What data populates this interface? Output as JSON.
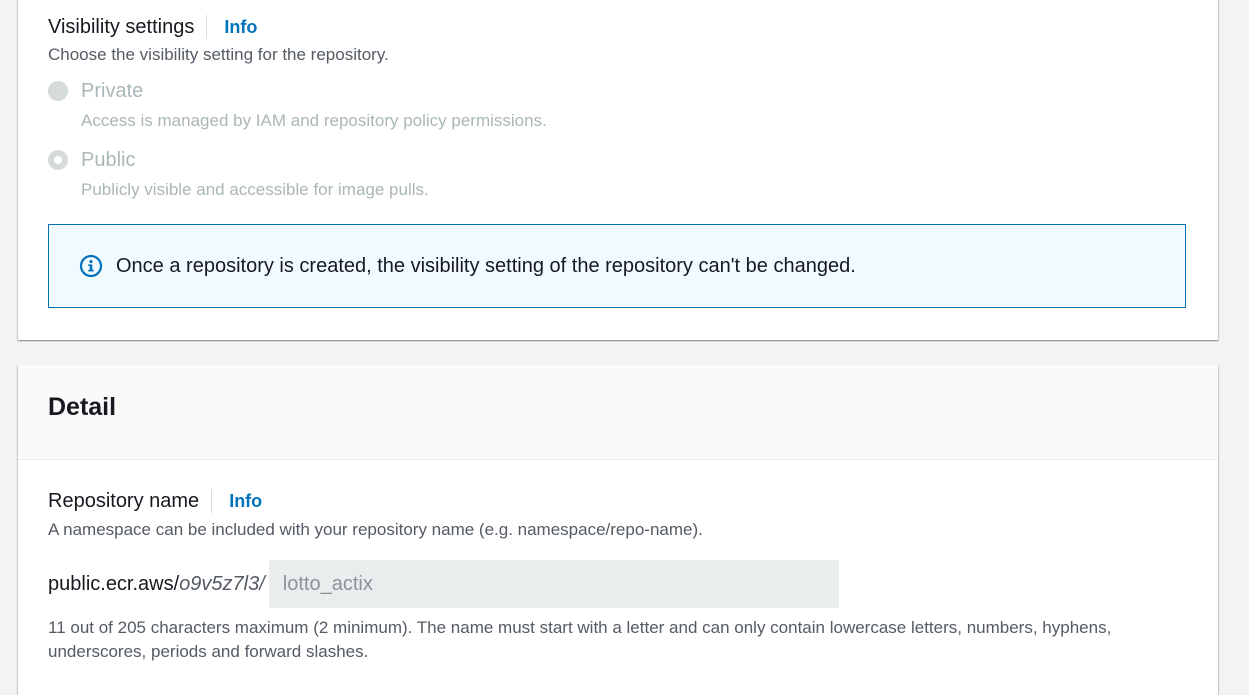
{
  "visibility": {
    "label": "Visibility settings",
    "info": "Info",
    "description": "Choose the visibility setting for the repository.",
    "options": [
      {
        "title": "Private",
        "subtitle": "Access is managed by IAM and repository policy permissions.",
        "checked": false,
        "disabled": true
      },
      {
        "title": "Public",
        "subtitle": "Publicly visible and accessible for image pulls.",
        "checked": true,
        "disabled": true
      }
    ],
    "alert": {
      "icon": "info-circle-icon",
      "text": "Once a repository is created, the visibility setting of the repository can't be changed."
    }
  },
  "detail": {
    "title": "Detail",
    "repository_name": {
      "label": "Repository name",
      "info": "Info",
      "description": "A namespace can be included with your repository name (e.g. namespace/repo-name).",
      "prefix": "public.ecr.aws/",
      "alias": "o9v5z7l3/",
      "value": "lotto_actix",
      "constraint": "11 out of 205 characters maximum (2 minimum). The name must start with a letter and can only contain lowercase letters, numbers, hyphens, underscores, periods and forward slashes."
    }
  },
  "colors": {
    "link": "#0073bb",
    "alert_bg": "#f1faff",
    "alert_border": "#0073bb",
    "disabled_text": "#aab7b8",
    "page_bg": "#f2f3f3"
  }
}
